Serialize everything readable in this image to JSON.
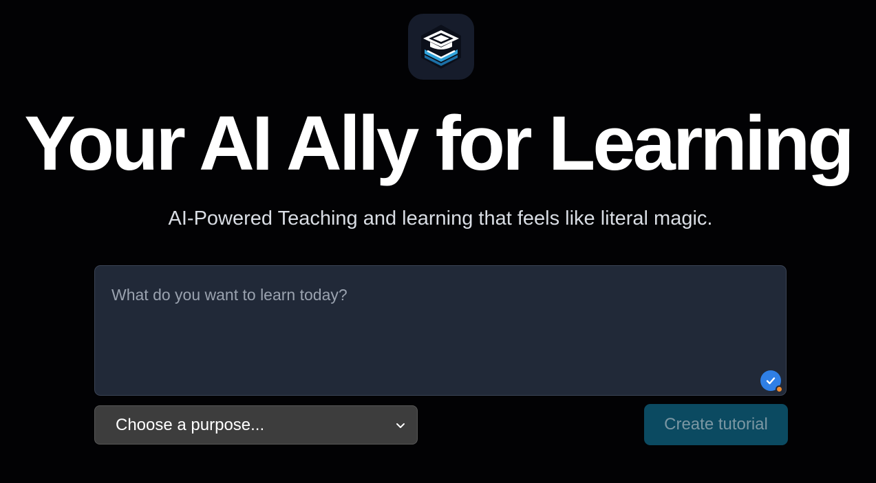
{
  "logo": {
    "icon": "graduation-cap-book-stack-icon"
  },
  "hero": {
    "title": "Your AI Ally for Learning",
    "subtitle": "AI-Powered Teaching and learning that feels like literal magic."
  },
  "prompt": {
    "value": "",
    "placeholder": "What do you want to learn today?",
    "badge_icon": "grammar-check-icon"
  },
  "purpose_select": {
    "selected": "Choose a purpose...",
    "icon": "chevron-down-icon"
  },
  "actions": {
    "create_label": "Create tutorial"
  },
  "colors": {
    "background": "#020204",
    "accent": "#2fa3dc",
    "button": "#0b4a61",
    "input_bg": "#212938"
  }
}
